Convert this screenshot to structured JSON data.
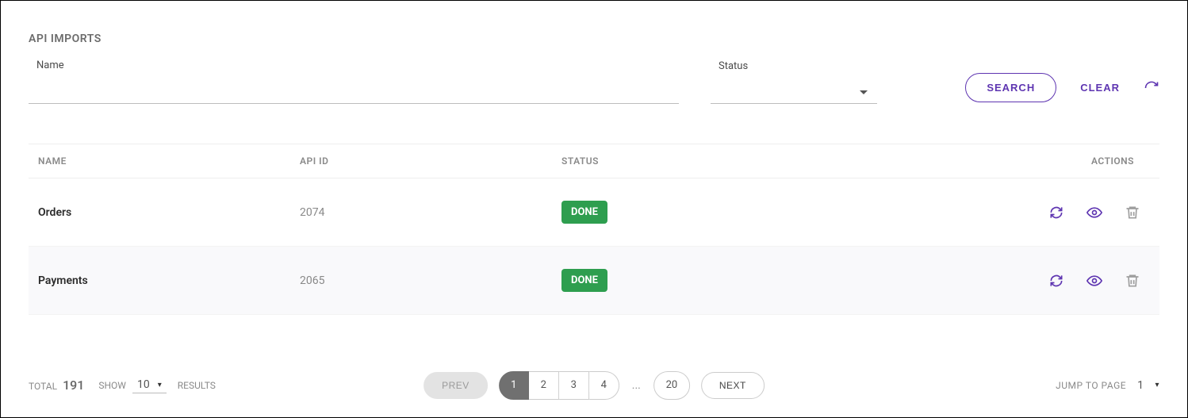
{
  "header": {
    "title": "API IMPORTS"
  },
  "filters": {
    "name_label": "Name",
    "name_value": "",
    "status_label": "Status",
    "status_value": "",
    "search_label": "SEARCH",
    "clear_label": "CLEAR"
  },
  "table": {
    "columns": {
      "name": "NAME",
      "api_id": "API ID",
      "status": "STATUS",
      "actions": "ACTIONS"
    },
    "rows": [
      {
        "name": "Orders",
        "api_id": "2074",
        "status": "DONE"
      },
      {
        "name": "Payments",
        "api_id": "2065",
        "status": "DONE"
      }
    ]
  },
  "footer": {
    "total_label": "TOTAL",
    "total_value": "191",
    "show_label": "SHOW",
    "show_value": "10",
    "results_label": "RESULTS",
    "prev_label": "PREV",
    "next_label": "NEXT",
    "pages_strip": [
      "1",
      "2",
      "3",
      "4"
    ],
    "active_page": "1",
    "ellipsis": "...",
    "last_page": "20",
    "jump_label": "JUMP TO PAGE",
    "jump_value": "1"
  }
}
